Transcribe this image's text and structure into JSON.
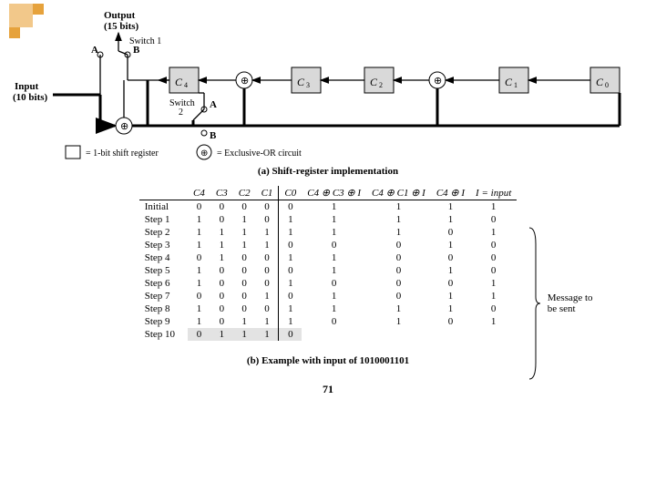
{
  "diagram": {
    "labels": {
      "output": "Output\n(15 bits)",
      "switch1": "Switch 1",
      "switch2": "Switch\n2",
      "a1": "A",
      "b1": "B",
      "a2": "A",
      "b2": "B",
      "input": "Input\n(10 bits)",
      "c4": "C4",
      "c3": "C3",
      "c2": "C2",
      "c1": "C1",
      "c0": "C0",
      "xor": "⊕"
    },
    "legend": {
      "reg": "= 1-bit shift register",
      "xor": "= Exclusive-OR circuit"
    },
    "caption_a": "(a) Shift-register implementation"
  },
  "table": {
    "headers": [
      "",
      "C4",
      "C3",
      "C2",
      "C1",
      "C0",
      "C4 ⊕ C3 ⊕ I",
      "C4 ⊕ C1 ⊕ I",
      "C4 ⊕ I",
      "I = input"
    ],
    "rows": [
      {
        "label": "Initial",
        "c4": "0",
        "c3": "0",
        "c2": "0",
        "c1": "0",
        "c0": "0",
        "e1": "1",
        "e2": "1",
        "e3": "1",
        "in": "1"
      },
      {
        "label": "Step 1",
        "c4": "1",
        "c3": "0",
        "c2": "1",
        "c1": "0",
        "c0": "1",
        "e1": "1",
        "e2": "1",
        "e3": "1",
        "in": "0"
      },
      {
        "label": "Step 2",
        "c4": "1",
        "c3": "1",
        "c2": "1",
        "c1": "1",
        "c0": "1",
        "e1": "1",
        "e2": "1",
        "e3": "0",
        "in": "1"
      },
      {
        "label": "Step 3",
        "c4": "1",
        "c3": "1",
        "c2": "1",
        "c1": "1",
        "c0": "0",
        "e1": "0",
        "e2": "0",
        "e3": "1",
        "in": "0"
      },
      {
        "label": "Step 4",
        "c4": "0",
        "c3": "1",
        "c2": "0",
        "c1": "0",
        "c0": "1",
        "e1": "1",
        "e2": "0",
        "e3": "0",
        "in": "0"
      },
      {
        "label": "Step 5",
        "c4": "1",
        "c3": "0",
        "c2": "0",
        "c1": "0",
        "c0": "0",
        "e1": "1",
        "e2": "0",
        "e3": "1",
        "in": "0"
      },
      {
        "label": "Step 6",
        "c4": "1",
        "c3": "0",
        "c2": "0",
        "c1": "0",
        "c0": "1",
        "e1": "0",
        "e2": "0",
        "e3": "0",
        "in": "1"
      },
      {
        "label": "Step 7",
        "c4": "0",
        "c3": "0",
        "c2": "0",
        "c1": "1",
        "c0": "0",
        "e1": "1",
        "e2": "0",
        "e3": "1",
        "in": "1"
      },
      {
        "label": "Step 8",
        "c4": "1",
        "c3": "0",
        "c2": "0",
        "c1": "0",
        "c0": "1",
        "e1": "1",
        "e2": "1",
        "e3": "1",
        "in": "0"
      },
      {
        "label": "Step 9",
        "c4": "1",
        "c3": "0",
        "c2": "1",
        "c1": "1",
        "c0": "1",
        "e1": "0",
        "e2": "1",
        "e3": "0",
        "in": "1"
      },
      {
        "label": "Step 10",
        "c4": "0",
        "c3": "1",
        "c2": "1",
        "c1": "1",
        "c0": "0",
        "e1": "",
        "e2": "",
        "e3": "",
        "in": ""
      }
    ],
    "caption_b": "(b) Example with input of 1010001101",
    "brace_label": "Message to\nbe sent"
  },
  "page_number": "71"
}
